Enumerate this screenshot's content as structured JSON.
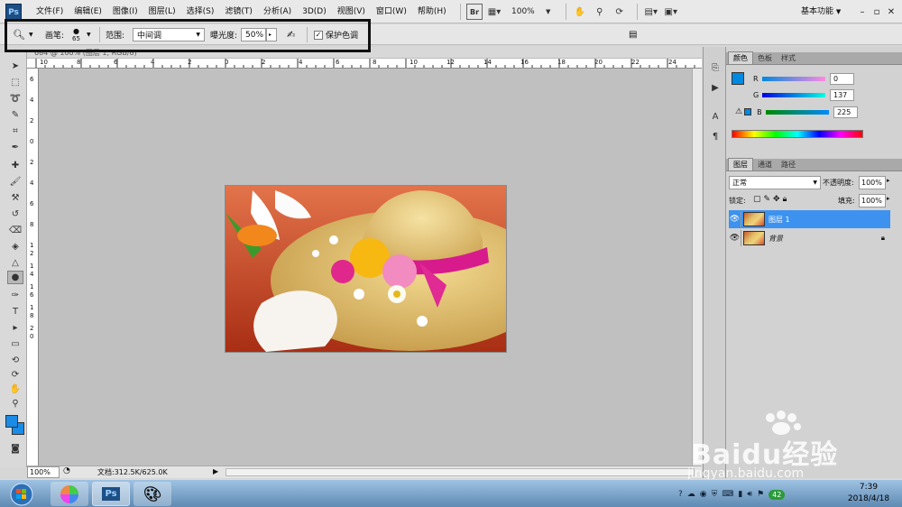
{
  "app": {
    "logo": "Ps",
    "menu": [
      "文件(F)",
      "编辑(E)",
      "图像(I)",
      "图层(L)",
      "选择(S)",
      "滤镜(T)",
      "分析(A)",
      "3D(D)",
      "视图(V)",
      "窗口(W)",
      "帮助(H)"
    ],
    "zoom": "100%",
    "workspace": "基本功能",
    "brand_color": "#1c4f86"
  },
  "options": {
    "brush_label": "画笔:",
    "brush_size": "65",
    "range_label": "范围:",
    "range_value": "中间调",
    "exposure_label": "曝光度:",
    "exposure_value": "50%",
    "protect_label": "保护色调",
    "protect_checked": "✓"
  },
  "document": {
    "tab_title": "684 @ 100% (图层 1, RGB/8)",
    "status_zoom": "100%",
    "status_doc": "文档:312.5K/625.0K",
    "ruler_top": [
      "10",
      "8",
      "6",
      "4",
      "2",
      "0",
      "2",
      "4",
      "6",
      "8",
      "10",
      "12",
      "14",
      "16",
      "18",
      "20",
      "22",
      "24"
    ],
    "ruler_left": [
      "6",
      "4",
      "2",
      "0",
      "2",
      "4",
      "6",
      "8",
      "1",
      "2",
      "1",
      "4",
      "1",
      "6",
      "1",
      "8",
      "2",
      "0"
    ]
  },
  "color_panel": {
    "tabs": [
      "颜色",
      "色板",
      "样式"
    ],
    "r_label": "R",
    "r_value": "0",
    "g_label": "G",
    "g_value": "137",
    "b_label": "B",
    "b_value": "225",
    "foreground": "#0089e1"
  },
  "layers_panel": {
    "tabs": [
      "图层",
      "通道",
      "路径"
    ],
    "blend_mode": "正常",
    "opacity_label": "不透明度:",
    "opacity_value": "100%",
    "lock_label": "锁定:",
    "fill_label": "填充:",
    "fill_value": "100%",
    "layers": [
      {
        "name": "图层 1",
        "selected": true
      },
      {
        "name": "背景",
        "selected": false
      }
    ],
    "selected_color": "#3d92f0"
  },
  "taskbar": {
    "time": "7:39",
    "date": "2018/4/18",
    "ps_label": "Ps",
    "tray_badge": "42"
  },
  "watermark": {
    "brand": "Baidu经验",
    "url": "jingyan.baidu.com"
  }
}
